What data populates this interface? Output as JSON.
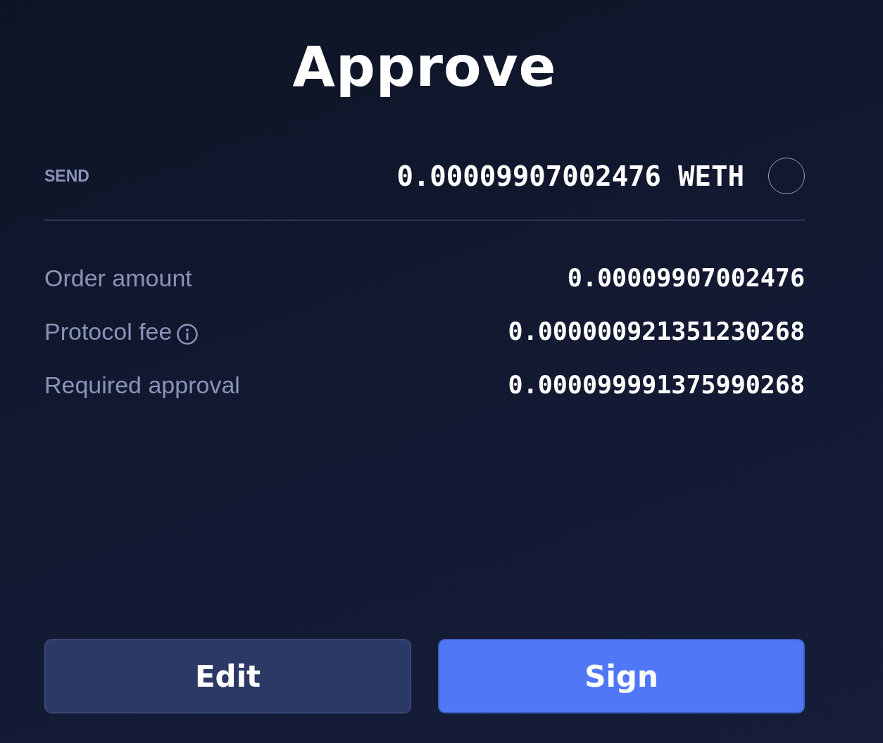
{
  "title": "Approve",
  "send": {
    "label": "SEND",
    "amount": "0.00009907002476",
    "token": "WETH"
  },
  "details": [
    {
      "label": "Order amount",
      "value": "0.00009907002476",
      "info": false
    },
    {
      "label": "Protocol fee",
      "value": "0.000000921351230268",
      "info": true
    },
    {
      "label": "Required approval",
      "value": "0.000099991375990268",
      "info": false
    }
  ],
  "buttons": [
    {
      "label": "Edit",
      "kind": "secondary"
    },
    {
      "label": "Sign",
      "kind": "primary"
    }
  ]
}
